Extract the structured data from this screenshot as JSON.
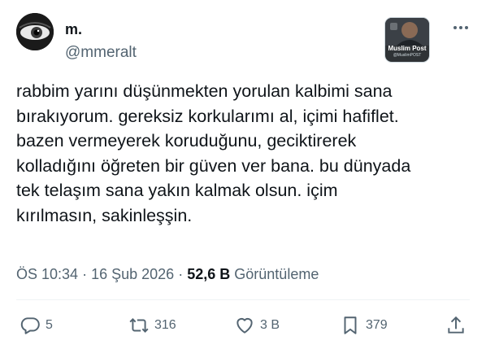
{
  "tweet": {
    "author_name": "m.",
    "author_handle": "@mmeralt",
    "text": "rabbim yarını düşünmekten yorulan kalbimi sana\nbırakıyorum. gereksiz korkularımı al, içimi hafiflet.\nbazen vermeyerek koruduğunu, geciktirerek\nkolladığını öğreten bir güven ver bana. bu dünyada\ntek telaşım sana yakın kalmak olsun. içim\nkırılmasın, sakinleşşin.",
    "time": "ÖS 10:34",
    "separator": "·",
    "date": "16 Şub 2026",
    "views_count": "52,6 B",
    "views_label": "Görüntüleme"
  },
  "watermark": {
    "title": "Muslim Post",
    "subtitle": "@MuslimPOST"
  },
  "actions": {
    "replies": "5",
    "retweets": "316",
    "likes": "3 B",
    "bookmarks": "379"
  },
  "icons": [
    "more-icon",
    "reply-icon",
    "retweet-icon",
    "like-icon",
    "bookmark-icon",
    "share-icon"
  ],
  "colors": {
    "text": "#0f1419",
    "secondary": "#536471",
    "divider": "#eff3f4"
  }
}
